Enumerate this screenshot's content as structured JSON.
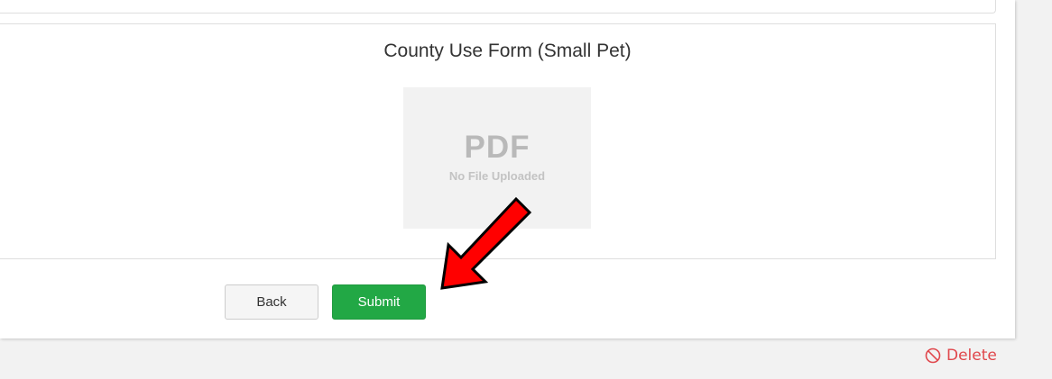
{
  "form": {
    "title": "County Use Form (Small Pet)",
    "preview": {
      "type_label": "PDF",
      "status_text": "No File Uploaded"
    }
  },
  "actions": {
    "back_label": "Back",
    "submit_label": "Submit"
  },
  "footer": {
    "delete_label": "Delete"
  },
  "colors": {
    "submit_green": "#22a845",
    "delete_red": "#e0474c",
    "annotation_arrow": "#ff0000"
  },
  "icons": {
    "delete": "prohibited-circle-icon",
    "annotation": "red-arrow-annotation"
  }
}
